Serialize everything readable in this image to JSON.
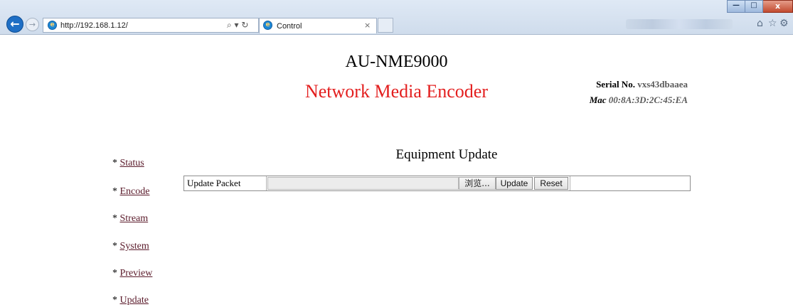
{
  "browser": {
    "url": "http://192.168.1.12/",
    "addr_controls": "⌕ ▾ ↻",
    "tab_title": "Control",
    "tab_close": "×",
    "back_glyph": "←",
    "forward_glyph": "→",
    "ie_glyph": "e",
    "right_icons": [
      "home-icon",
      "favorites-star-icon",
      "settings-gear-icon"
    ],
    "right_icon_glyphs": [
      "⌂",
      "☆",
      "⚙"
    ],
    "window_controls": {
      "minimize": "—",
      "maximize": "□",
      "close": "x"
    }
  },
  "header": {
    "model": "AU-NME9000",
    "product": "Network Media Encoder",
    "serial_label": "Serial No.",
    "serial_value": "vxs43dbaaea",
    "mac_label": "Mac",
    "mac_value": "00:8A:3D:2C:45:EA"
  },
  "colors": {
    "product_title": "#e31e1e",
    "nav_link": "#5a1a2a",
    "back_button": "#1f6fc5",
    "close_button": "#c24a2f"
  },
  "nav": {
    "bullet": "*",
    "items": [
      {
        "label": "Status"
      },
      {
        "label": "Encode"
      },
      {
        "label": "Stream"
      },
      {
        "label": "System"
      },
      {
        "label": "Preview"
      },
      {
        "label": "Update"
      }
    ]
  },
  "main": {
    "section_title": "Equipment Update",
    "update_packet_label": "Update  Packet",
    "browse_label": "浏览...",
    "update_button": "Update",
    "reset_button": "Reset"
  }
}
